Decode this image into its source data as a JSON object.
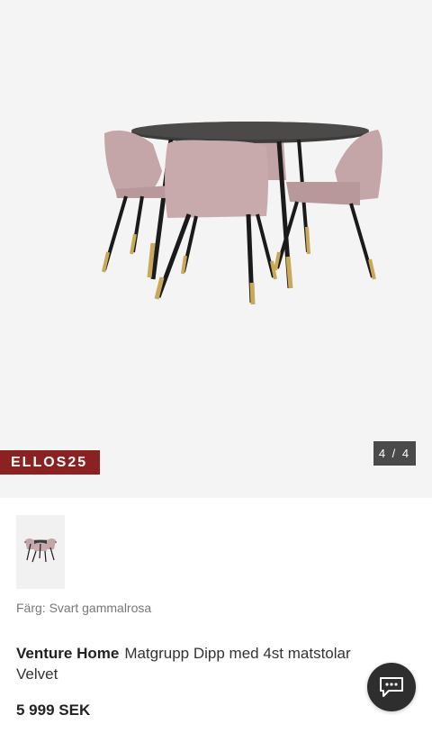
{
  "gallery": {
    "promo_badge": "ELLOS25",
    "counter": "4 / 4"
  },
  "product": {
    "color_label": "Färg: Svart gammalrosa",
    "brand": "Venture Home",
    "name": "Matgrupp Dipp med 4st matstolar Velvet",
    "price": "5 999 SEK"
  },
  "icons": {
    "chat": "chat-bubble-icon"
  },
  "colors": {
    "promo": "#8c2121",
    "chair": "#c7a8ab",
    "table_top": "#3a3a3a"
  }
}
